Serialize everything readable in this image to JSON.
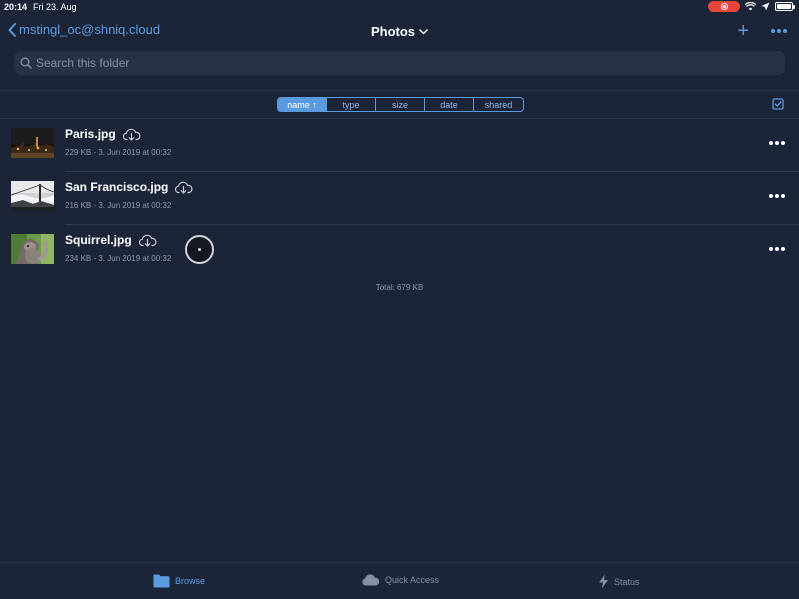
{
  "status_bar": {
    "time": "20:14",
    "date": "Fri 23. Aug"
  },
  "nav": {
    "back_label": "mstingl_oc@shniq.cloud",
    "title": "Photos"
  },
  "search": {
    "placeholder": "Search this folder"
  },
  "sort": {
    "segments": [
      {
        "label": "name ↑",
        "active": true
      },
      {
        "label": "type",
        "active": false
      },
      {
        "label": "size",
        "active": false
      },
      {
        "label": "date",
        "active": false
      },
      {
        "label": "shared",
        "active": false
      }
    ]
  },
  "files": [
    {
      "name": "Paris.jpg",
      "meta": "229 KB - 3. Jun 2019 at 00:32"
    },
    {
      "name": "San Francisco.jpg",
      "meta": "216 KB - 3. Jun 2019 at 00:32"
    },
    {
      "name": "Squirrel.jpg",
      "meta": "234 KB - 3. Jun 2019 at 00:32"
    }
  ],
  "total": "Total: 679 KB",
  "tabs": [
    {
      "label": "Browse",
      "icon": "folder-icon",
      "active": true
    },
    {
      "label": "Quick Access",
      "icon": "cloud-icon",
      "active": false
    },
    {
      "label": "Status",
      "icon": "bolt-icon",
      "active": false
    }
  ],
  "colors": {
    "accent": "#5a9be0",
    "background": "#1c2538",
    "recording": "#e8453c"
  }
}
